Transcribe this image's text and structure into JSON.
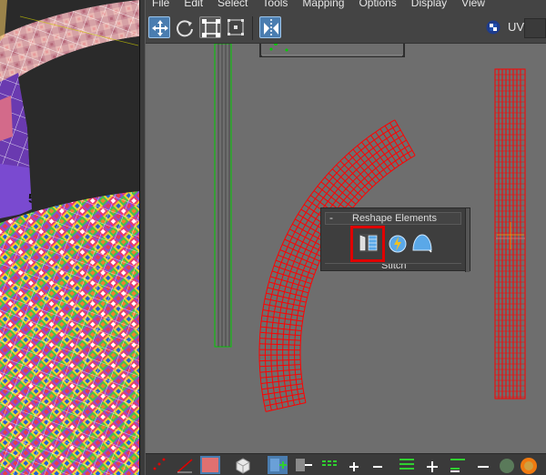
{
  "menu": {
    "items": [
      "File",
      "Edit",
      "Select",
      "Tools",
      "Mapping",
      "Options",
      "Display",
      "View"
    ]
  },
  "toolbar": {
    "move_tool": "move-icon",
    "rotate_tool": "rotate-icon",
    "scale_tool": "scale-icon",
    "freeform_tool": "freeform-icon",
    "mirror_tool": "mirror-icon",
    "uv_label": "UV"
  },
  "reshape_panel": {
    "collapse_symbol": "-",
    "title": "Reshape Elements",
    "buttons": [
      "straighten-selection-icon",
      "relax-icon",
      "arc-icon"
    ],
    "next_section_title": "Stitch"
  },
  "colors": {
    "uv_selected": "#ff0000",
    "uv_unselected": "#00cc00",
    "highlight": "#e00000",
    "accent": "#4a7db0"
  }
}
